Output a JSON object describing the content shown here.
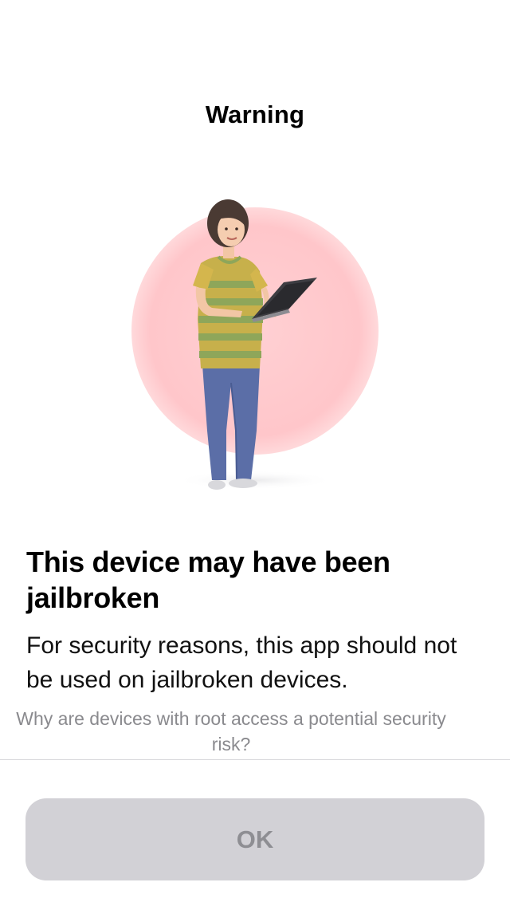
{
  "nav": {
    "title": "Warning"
  },
  "illustration": {
    "icon": "woman-with-laptop-illustration",
    "accent_color": "#ffc9cc"
  },
  "content": {
    "headline": "This device may have been jailbroken",
    "body": "For security reasons, this app should not be used on jailbroken devices.",
    "info_link": "Why are devices with root access a potential security risk?"
  },
  "actions": {
    "ok_label": "OK",
    "ok_enabled": false
  },
  "colors": {
    "button_bg": "#d2d1d6",
    "button_text": "#8e8e93",
    "secondary_text": "#8a8a8e"
  }
}
